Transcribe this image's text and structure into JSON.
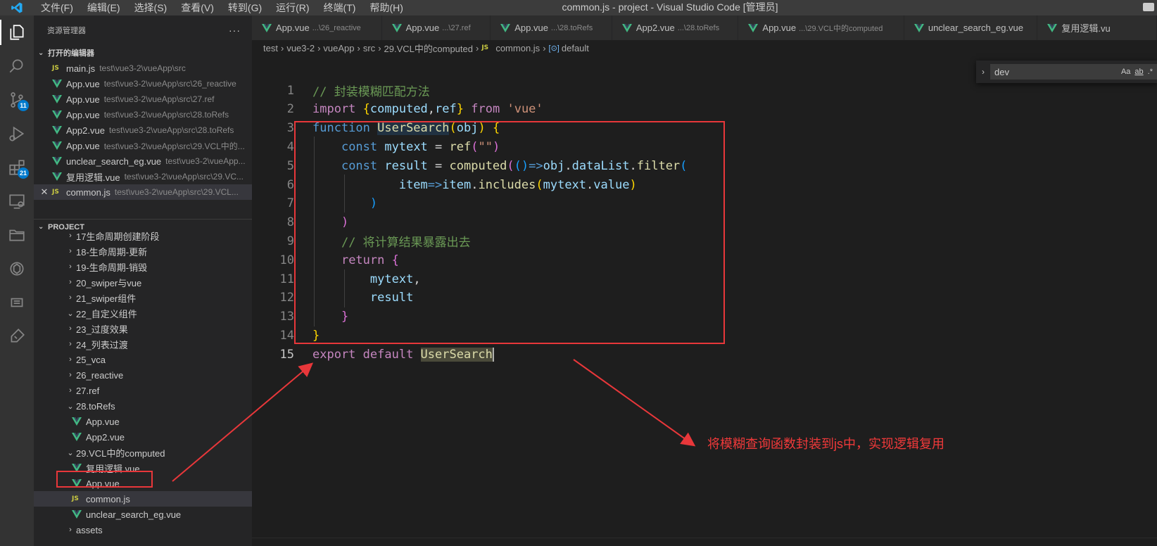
{
  "window": {
    "title": "common.js - project - Visual Studio Code [管理员]",
    "menu": [
      "文件(F)",
      "编辑(E)",
      "选择(S)",
      "查看(V)",
      "转到(G)",
      "运行(R)",
      "终端(T)",
      "帮助(H)"
    ]
  },
  "activity_bar": {
    "badges": {
      "scm": "11",
      "extensions": "21"
    }
  },
  "sidebar": {
    "title": "资源管理器",
    "more": "···",
    "open_editors": {
      "label": "打开的编辑器",
      "items": [
        {
          "name": "main.js",
          "path": "test\\vue3-2\\vueApp\\src",
          "type": "js"
        },
        {
          "name": "App.vue",
          "path": "test\\vue3-2\\vueApp\\src\\26_reactive",
          "type": "vue"
        },
        {
          "name": "App.vue",
          "path": "test\\vue3-2\\vueApp\\src\\27.ref",
          "type": "vue"
        },
        {
          "name": "App.vue",
          "path": "test\\vue3-2\\vueApp\\src\\28.toRefs",
          "type": "vue"
        },
        {
          "name": "App2.vue",
          "path": "test\\vue3-2\\vueApp\\src\\28.toRefs",
          "type": "vue"
        },
        {
          "name": "App.vue",
          "path": "test\\vue3-2\\vueApp\\src\\29.VCL中的...",
          "type": "vue"
        },
        {
          "name": "unclear_search_eg.vue",
          "path": "test\\vue3-2\\vueApp...",
          "type": "vue"
        },
        {
          "name": "复用逻辑.vue",
          "path": "test\\vue3-2\\vueApp\\src\\29.VC...",
          "type": "vue"
        },
        {
          "name": "common.js",
          "path": "test\\vue3-2\\vueApp\\src\\29.VCL...",
          "type": "js",
          "close": "✕"
        }
      ]
    },
    "project": {
      "label": "PROJECT",
      "items": [
        {
          "name": "17生命周期创建阶段",
          "type": "folder",
          "state": "collapsed",
          "depth": 1
        },
        {
          "name": "18-生命周期-更新",
          "type": "folder",
          "state": "collapsed",
          "depth": 1
        },
        {
          "name": "19-生命周期-销毁",
          "type": "folder",
          "state": "collapsed",
          "depth": 1
        },
        {
          "name": "20_swiper与vue",
          "type": "folder",
          "state": "collapsed",
          "depth": 1
        },
        {
          "name": "21_swiper组件",
          "type": "folder",
          "state": "collapsed",
          "depth": 1
        },
        {
          "name": "22_自定义组件",
          "type": "folder",
          "state": "expanded",
          "depth": 1
        },
        {
          "name": "23_过度效果",
          "type": "folder",
          "state": "collapsed",
          "depth": 1
        },
        {
          "name": "24_列表过渡",
          "type": "folder",
          "state": "collapsed",
          "depth": 1
        },
        {
          "name": "25_vca",
          "type": "folder",
          "state": "collapsed",
          "depth": 1
        },
        {
          "name": "26_reactive",
          "type": "folder",
          "state": "collapsed",
          "depth": 1
        },
        {
          "name": "27.ref",
          "type": "folder",
          "state": "collapsed",
          "depth": 1
        },
        {
          "name": "28.toRefs",
          "type": "folder",
          "state": "expanded",
          "depth": 1
        },
        {
          "name": "App.vue",
          "type": "vue",
          "depth": 2
        },
        {
          "name": "App2.vue",
          "type": "vue",
          "depth": 2
        },
        {
          "name": "29.VCL中的computed",
          "type": "folder",
          "state": "expanded",
          "depth": 1
        },
        {
          "name": "复用逻辑.vue",
          "type": "vue",
          "depth": 2
        },
        {
          "name": "App.vue",
          "type": "vue",
          "depth": 2
        },
        {
          "name": "common.js",
          "type": "js",
          "depth": 2,
          "selected": true
        },
        {
          "name": "unclear_search_eg.vue",
          "type": "vue",
          "depth": 2
        },
        {
          "name": "assets",
          "type": "folder",
          "state": "collapsed",
          "depth": 1
        }
      ]
    }
  },
  "tabs": [
    {
      "name": "App.vue",
      "desc": "...\\26_reactive"
    },
    {
      "name": "App.vue",
      "desc": "...\\27.ref"
    },
    {
      "name": "App.vue",
      "desc": "...\\28.toRefs"
    },
    {
      "name": "App2.vue",
      "desc": "...\\28.toRefs"
    },
    {
      "name": "App.vue",
      "desc": "...\\29.VCL中的computed"
    },
    {
      "name": "unclear_search_eg.vue",
      "desc": ""
    },
    {
      "name": "复用逻辑.vu",
      "desc": ""
    }
  ],
  "breadcrumb": [
    "test",
    "vue3-2",
    "vueApp",
    "src",
    "29.VCL中的computed",
    "common.js",
    "default"
  ],
  "find_widget": {
    "value": "dev",
    "options": [
      "Aa",
      "ab",
      ".*"
    ]
  },
  "editor": {
    "current_line": "15",
    "lines": [
      {
        "n": "1",
        "tokens": [
          [
            "c-com",
            "// 封装模糊匹配方法"
          ]
        ]
      },
      {
        "n": "2",
        "tokens": [
          [
            "c-ctl",
            "import "
          ],
          [
            "c-b1",
            "{"
          ],
          [
            "c-var",
            "computed"
          ],
          [
            "",
            ","
          ],
          [
            "c-var",
            "ref"
          ],
          [
            "c-b1",
            "}"
          ],
          [
            "",
            " "
          ],
          [
            "c-ctl",
            "from"
          ],
          [
            "",
            " "
          ],
          [
            "c-str",
            "'vue'"
          ]
        ]
      },
      {
        "n": "3",
        "tokens": [
          [
            "c-kw",
            "function "
          ],
          [
            "c-fn hl-word",
            "UserSearch"
          ],
          [
            "c-b1",
            "("
          ],
          [
            "c-var",
            "obj"
          ],
          [
            "c-b1",
            ")"
          ],
          [
            "",
            " "
          ],
          [
            "c-b1",
            "{"
          ]
        ]
      },
      {
        "n": "4",
        "tokens": [
          [
            "",
            "    "
          ],
          [
            "c-kw",
            "const "
          ],
          [
            "c-var",
            "mytext"
          ],
          [
            "",
            " = "
          ],
          [
            "c-fn",
            "ref"
          ],
          [
            "c-b2",
            "("
          ],
          [
            "c-str",
            "\"\""
          ],
          [
            "c-b2",
            ")"
          ]
        ]
      },
      {
        "n": "5",
        "tokens": [
          [
            "",
            "    "
          ],
          [
            "c-kw",
            "const "
          ],
          [
            "c-var",
            "result"
          ],
          [
            "",
            " = "
          ],
          [
            "c-fn",
            "computed"
          ],
          [
            "c-b2",
            "("
          ],
          [
            "c-b3",
            "("
          ],
          [
            "c-b3",
            ")"
          ],
          [
            "c-kw",
            "=>"
          ],
          [
            "c-var",
            "obj"
          ],
          [
            "",
            "."
          ],
          [
            "c-var",
            "dataList"
          ],
          [
            "",
            "."
          ],
          [
            "c-fn",
            "filter"
          ],
          [
            "c-b3",
            "("
          ]
        ]
      },
      {
        "n": "6",
        "tokens": [
          [
            "",
            "            "
          ],
          [
            "c-var",
            "item"
          ],
          [
            "c-kw",
            "=>"
          ],
          [
            "c-var",
            "item"
          ],
          [
            "",
            "."
          ],
          [
            "c-fn",
            "includes"
          ],
          [
            "c-b1",
            "("
          ],
          [
            "c-var",
            "mytext"
          ],
          [
            "",
            "."
          ],
          [
            "c-var",
            "value"
          ],
          [
            "c-b1",
            ")"
          ]
        ]
      },
      {
        "n": "7",
        "tokens": [
          [
            "",
            "        "
          ],
          [
            "c-b3",
            ")"
          ]
        ]
      },
      {
        "n": "8",
        "tokens": [
          [
            "",
            "    "
          ],
          [
            "c-b2",
            ")"
          ]
        ]
      },
      {
        "n": "9",
        "tokens": [
          [
            "",
            "    "
          ],
          [
            "c-com",
            "// 将计算结果暴露出去"
          ]
        ]
      },
      {
        "n": "10",
        "tokens": [
          [
            "",
            "    "
          ],
          [
            "c-ctl",
            "return "
          ],
          [
            "c-b2",
            "{"
          ]
        ]
      },
      {
        "n": "11",
        "tokens": [
          [
            "",
            "        "
          ],
          [
            "c-var",
            "mytext"
          ],
          [
            "",
            ","
          ]
        ]
      },
      {
        "n": "12",
        "tokens": [
          [
            "",
            "        "
          ],
          [
            "c-var",
            "result"
          ]
        ]
      },
      {
        "n": "13",
        "tokens": [
          [
            "",
            "    "
          ],
          [
            "c-b2",
            "}"
          ]
        ]
      },
      {
        "n": "14",
        "tokens": [
          [
            "c-b1",
            "}"
          ]
        ]
      },
      {
        "n": "15",
        "tokens": [
          [
            "c-ctl",
            "export "
          ],
          [
            "c-ctl",
            "default "
          ],
          [
            "c-fn hl-export",
            "UserSearch"
          ]
        ]
      }
    ]
  },
  "annotation": {
    "text": "将模糊查询函数封装到js中，实现逻辑复用",
    "color": "#f0393a"
  },
  "colors": {
    "vue_icon": "#42b883",
    "accent": "#007acc"
  }
}
